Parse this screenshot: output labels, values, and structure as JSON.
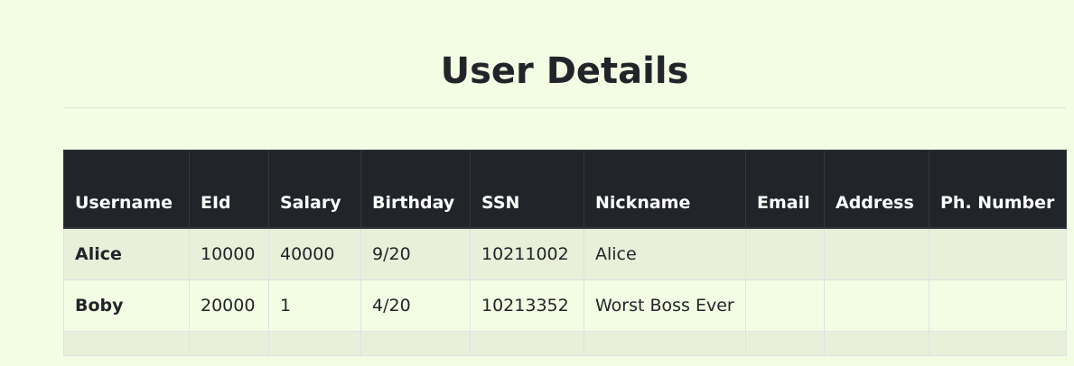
{
  "page": {
    "title": "User Details"
  },
  "table": {
    "headers": [
      "Username",
      "EId",
      "Salary",
      "Birthday",
      "SSN",
      "Nickname",
      "Email",
      "Address",
      "Ph. Number"
    ],
    "rows": [
      {
        "username": "Alice",
        "eid": "10000",
        "salary": "40000",
        "birthday": "9/20",
        "ssn": "10211002",
        "nickname": "Alice",
        "email": "",
        "address": "",
        "phone": ""
      },
      {
        "username": "Boby",
        "eid": "20000",
        "salary": "1",
        "birthday": "4/20",
        "ssn": "10213352",
        "nickname": "Worst Boss Ever",
        "email": "",
        "address": "",
        "phone": ""
      },
      {
        "username": "",
        "eid": "",
        "salary": "",
        "birthday": "",
        "ssn": "",
        "nickname": "",
        "email": "",
        "address": "",
        "phone": ""
      }
    ]
  }
}
